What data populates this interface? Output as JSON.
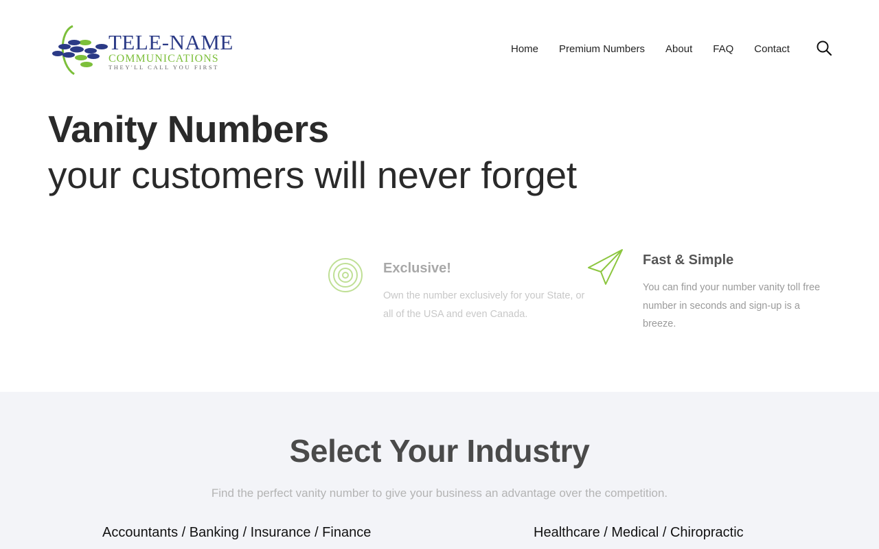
{
  "brand": {
    "name": "TELE-NAME",
    "sub": "COMMUNICATIONS",
    "tagline": "THEY'LL CALL YOU FIRST",
    "colors": {
      "navy": "#2b3a86",
      "green": "#7cbf3a"
    }
  },
  "nav": {
    "items": [
      {
        "label": "Home"
      },
      {
        "label": "Premium Numbers"
      },
      {
        "label": "About"
      },
      {
        "label": "FAQ"
      },
      {
        "label": "Contact"
      }
    ],
    "search_icon": "search-icon"
  },
  "hero": {
    "title_bold": "Vanity Numbers",
    "title_light": "your customers will never forget"
  },
  "features": [
    {
      "icon": "target-icon",
      "title": "Exclusive!",
      "description": "Own the number exclusively for your State, or all of the USA and even Canada."
    },
    {
      "icon": "paper-plane-icon",
      "title": "Fast & Simple",
      "description": "You can find your number vanity toll free number in seconds and sign-up is a breeze."
    }
  ],
  "industry": {
    "title": "Select Your Industry",
    "subtitle": "Find the perfect vanity number to give your business an advantage over the competition.",
    "links": [
      {
        "label": "Accountants / Banking / Insurance / Finance"
      },
      {
        "label": "Healthcare / Medical / Chiropractic"
      }
    ]
  },
  "accent_color": "#8cc63f"
}
